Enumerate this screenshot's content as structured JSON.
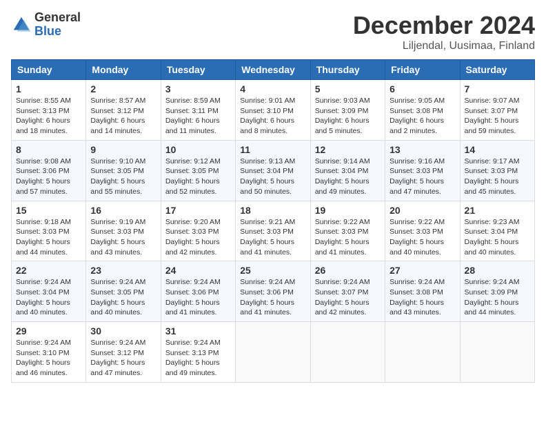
{
  "header": {
    "logo_general": "General",
    "logo_blue": "Blue",
    "month_title": "December 2024",
    "location": "Liljendal, Uusimaa, Finland"
  },
  "days_of_week": [
    "Sunday",
    "Monday",
    "Tuesday",
    "Wednesday",
    "Thursday",
    "Friday",
    "Saturday"
  ],
  "weeks": [
    [
      {
        "day": "1",
        "sunrise": "8:55 AM",
        "sunset": "3:13 PM",
        "daylight": "6 hours and 18 minutes."
      },
      {
        "day": "2",
        "sunrise": "8:57 AM",
        "sunset": "3:12 PM",
        "daylight": "6 hours and 14 minutes."
      },
      {
        "day": "3",
        "sunrise": "8:59 AM",
        "sunset": "3:11 PM",
        "daylight": "6 hours and 11 minutes."
      },
      {
        "day": "4",
        "sunrise": "9:01 AM",
        "sunset": "3:10 PM",
        "daylight": "6 hours and 8 minutes."
      },
      {
        "day": "5",
        "sunrise": "9:03 AM",
        "sunset": "3:09 PM",
        "daylight": "6 hours and 5 minutes."
      },
      {
        "day": "6",
        "sunrise": "9:05 AM",
        "sunset": "3:08 PM",
        "daylight": "6 hours and 2 minutes."
      },
      {
        "day": "7",
        "sunrise": "9:07 AM",
        "sunset": "3:07 PM",
        "daylight": "5 hours and 59 minutes."
      }
    ],
    [
      {
        "day": "8",
        "sunrise": "9:08 AM",
        "sunset": "3:06 PM",
        "daylight": "5 hours and 57 minutes."
      },
      {
        "day": "9",
        "sunrise": "9:10 AM",
        "sunset": "3:05 PM",
        "daylight": "5 hours and 55 minutes."
      },
      {
        "day": "10",
        "sunrise": "9:12 AM",
        "sunset": "3:05 PM",
        "daylight": "5 hours and 52 minutes."
      },
      {
        "day": "11",
        "sunrise": "9:13 AM",
        "sunset": "3:04 PM",
        "daylight": "5 hours and 50 minutes."
      },
      {
        "day": "12",
        "sunrise": "9:14 AM",
        "sunset": "3:04 PM",
        "daylight": "5 hours and 49 minutes."
      },
      {
        "day": "13",
        "sunrise": "9:16 AM",
        "sunset": "3:03 PM",
        "daylight": "5 hours and 47 minutes."
      },
      {
        "day": "14",
        "sunrise": "9:17 AM",
        "sunset": "3:03 PM",
        "daylight": "5 hours and 45 minutes."
      }
    ],
    [
      {
        "day": "15",
        "sunrise": "9:18 AM",
        "sunset": "3:03 PM",
        "daylight": "5 hours and 44 minutes."
      },
      {
        "day": "16",
        "sunrise": "9:19 AM",
        "sunset": "3:03 PM",
        "daylight": "5 hours and 43 minutes."
      },
      {
        "day": "17",
        "sunrise": "9:20 AM",
        "sunset": "3:03 PM",
        "daylight": "5 hours and 42 minutes."
      },
      {
        "day": "18",
        "sunrise": "9:21 AM",
        "sunset": "3:03 PM",
        "daylight": "5 hours and 41 minutes."
      },
      {
        "day": "19",
        "sunrise": "9:22 AM",
        "sunset": "3:03 PM",
        "daylight": "5 hours and 41 minutes."
      },
      {
        "day": "20",
        "sunrise": "9:22 AM",
        "sunset": "3:03 PM",
        "daylight": "5 hours and 40 minutes."
      },
      {
        "day": "21",
        "sunrise": "9:23 AM",
        "sunset": "3:04 PM",
        "daylight": "5 hours and 40 minutes."
      }
    ],
    [
      {
        "day": "22",
        "sunrise": "9:24 AM",
        "sunset": "3:04 PM",
        "daylight": "5 hours and 40 minutes."
      },
      {
        "day": "23",
        "sunrise": "9:24 AM",
        "sunset": "3:05 PM",
        "daylight": "5 hours and 40 minutes."
      },
      {
        "day": "24",
        "sunrise": "9:24 AM",
        "sunset": "3:06 PM",
        "daylight": "5 hours and 41 minutes."
      },
      {
        "day": "25",
        "sunrise": "9:24 AM",
        "sunset": "3:06 PM",
        "daylight": "5 hours and 41 minutes."
      },
      {
        "day": "26",
        "sunrise": "9:24 AM",
        "sunset": "3:07 PM",
        "daylight": "5 hours and 42 minutes."
      },
      {
        "day": "27",
        "sunrise": "9:24 AM",
        "sunset": "3:08 PM",
        "daylight": "5 hours and 43 minutes."
      },
      {
        "day": "28",
        "sunrise": "9:24 AM",
        "sunset": "3:09 PM",
        "daylight": "5 hours and 44 minutes."
      }
    ],
    [
      {
        "day": "29",
        "sunrise": "9:24 AM",
        "sunset": "3:10 PM",
        "daylight": "5 hours and 46 minutes."
      },
      {
        "day": "30",
        "sunrise": "9:24 AM",
        "sunset": "3:12 PM",
        "daylight": "5 hours and 47 minutes."
      },
      {
        "day": "31",
        "sunrise": "9:24 AM",
        "sunset": "3:13 PM",
        "daylight": "5 hours and 49 minutes."
      },
      null,
      null,
      null,
      null
    ]
  ]
}
